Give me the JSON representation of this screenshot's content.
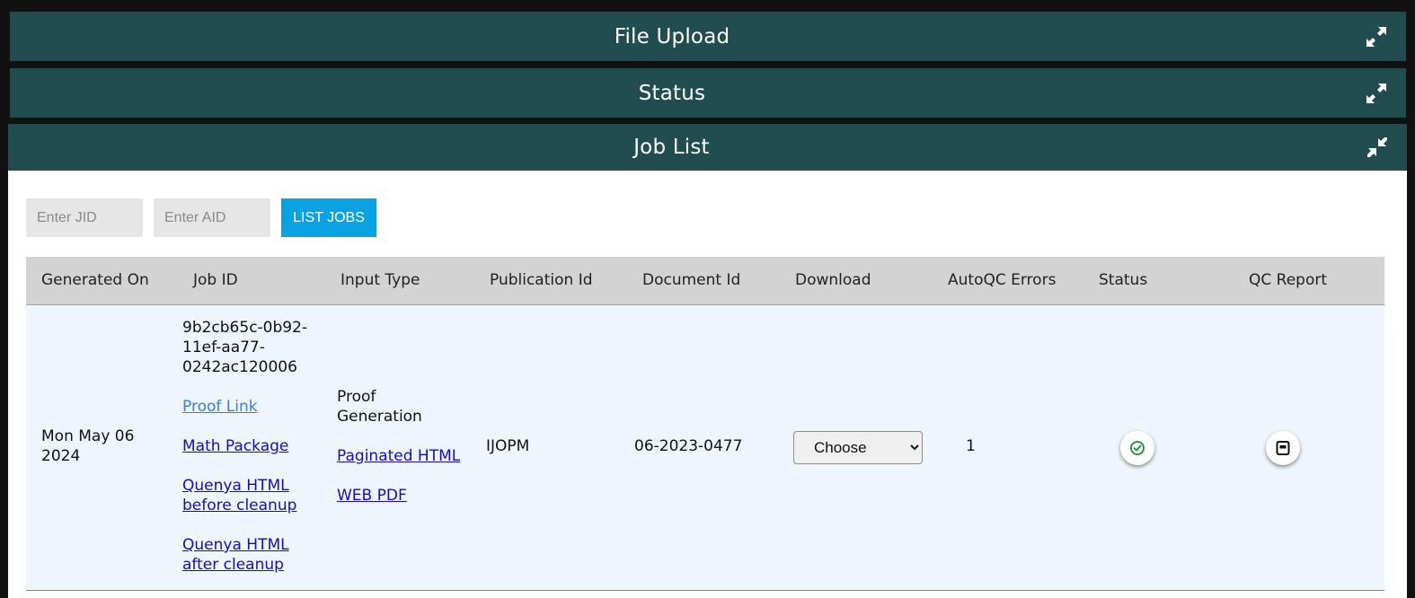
{
  "panels": {
    "file_upload": "File Upload",
    "status": "Status",
    "job_list": "Job List"
  },
  "filters": {
    "jid_placeholder": "Enter JID",
    "aid_placeholder": "Enter AID",
    "list_jobs_label": "LIST JOBS"
  },
  "table": {
    "columns": [
      "Generated On",
      "Job ID",
      "Input Type",
      "Publication Id",
      "Document Id",
      "Download",
      "AutoQC Errors",
      "Status",
      "QC Report"
    ],
    "rows": [
      {
        "generated_on": "Mon May 06 2024",
        "job_id": "9b2cb65c-0b92-11ef-aa77-0242ac120006",
        "job_links": [
          "Proof Link",
          "Math Package",
          "Quenya HTML before cleanup",
          "Quenya HTML after cleanup"
        ],
        "input_type": "Proof Generation",
        "input_links": [
          "Paginated HTML",
          "WEB PDF"
        ],
        "publication_id": "IJOPM",
        "document_id": "06-2023-0477",
        "download_selected": "Choose",
        "autoqc_errors": "1",
        "status_icon": "check-circle-icon",
        "qc_report_icon": "report-icon"
      }
    ]
  },
  "colors": {
    "header_bg": "#224d50",
    "button_bg": "#0ba2e4",
    "row_bg": "#eef5fc",
    "status_ok": "#1a8a2a"
  }
}
